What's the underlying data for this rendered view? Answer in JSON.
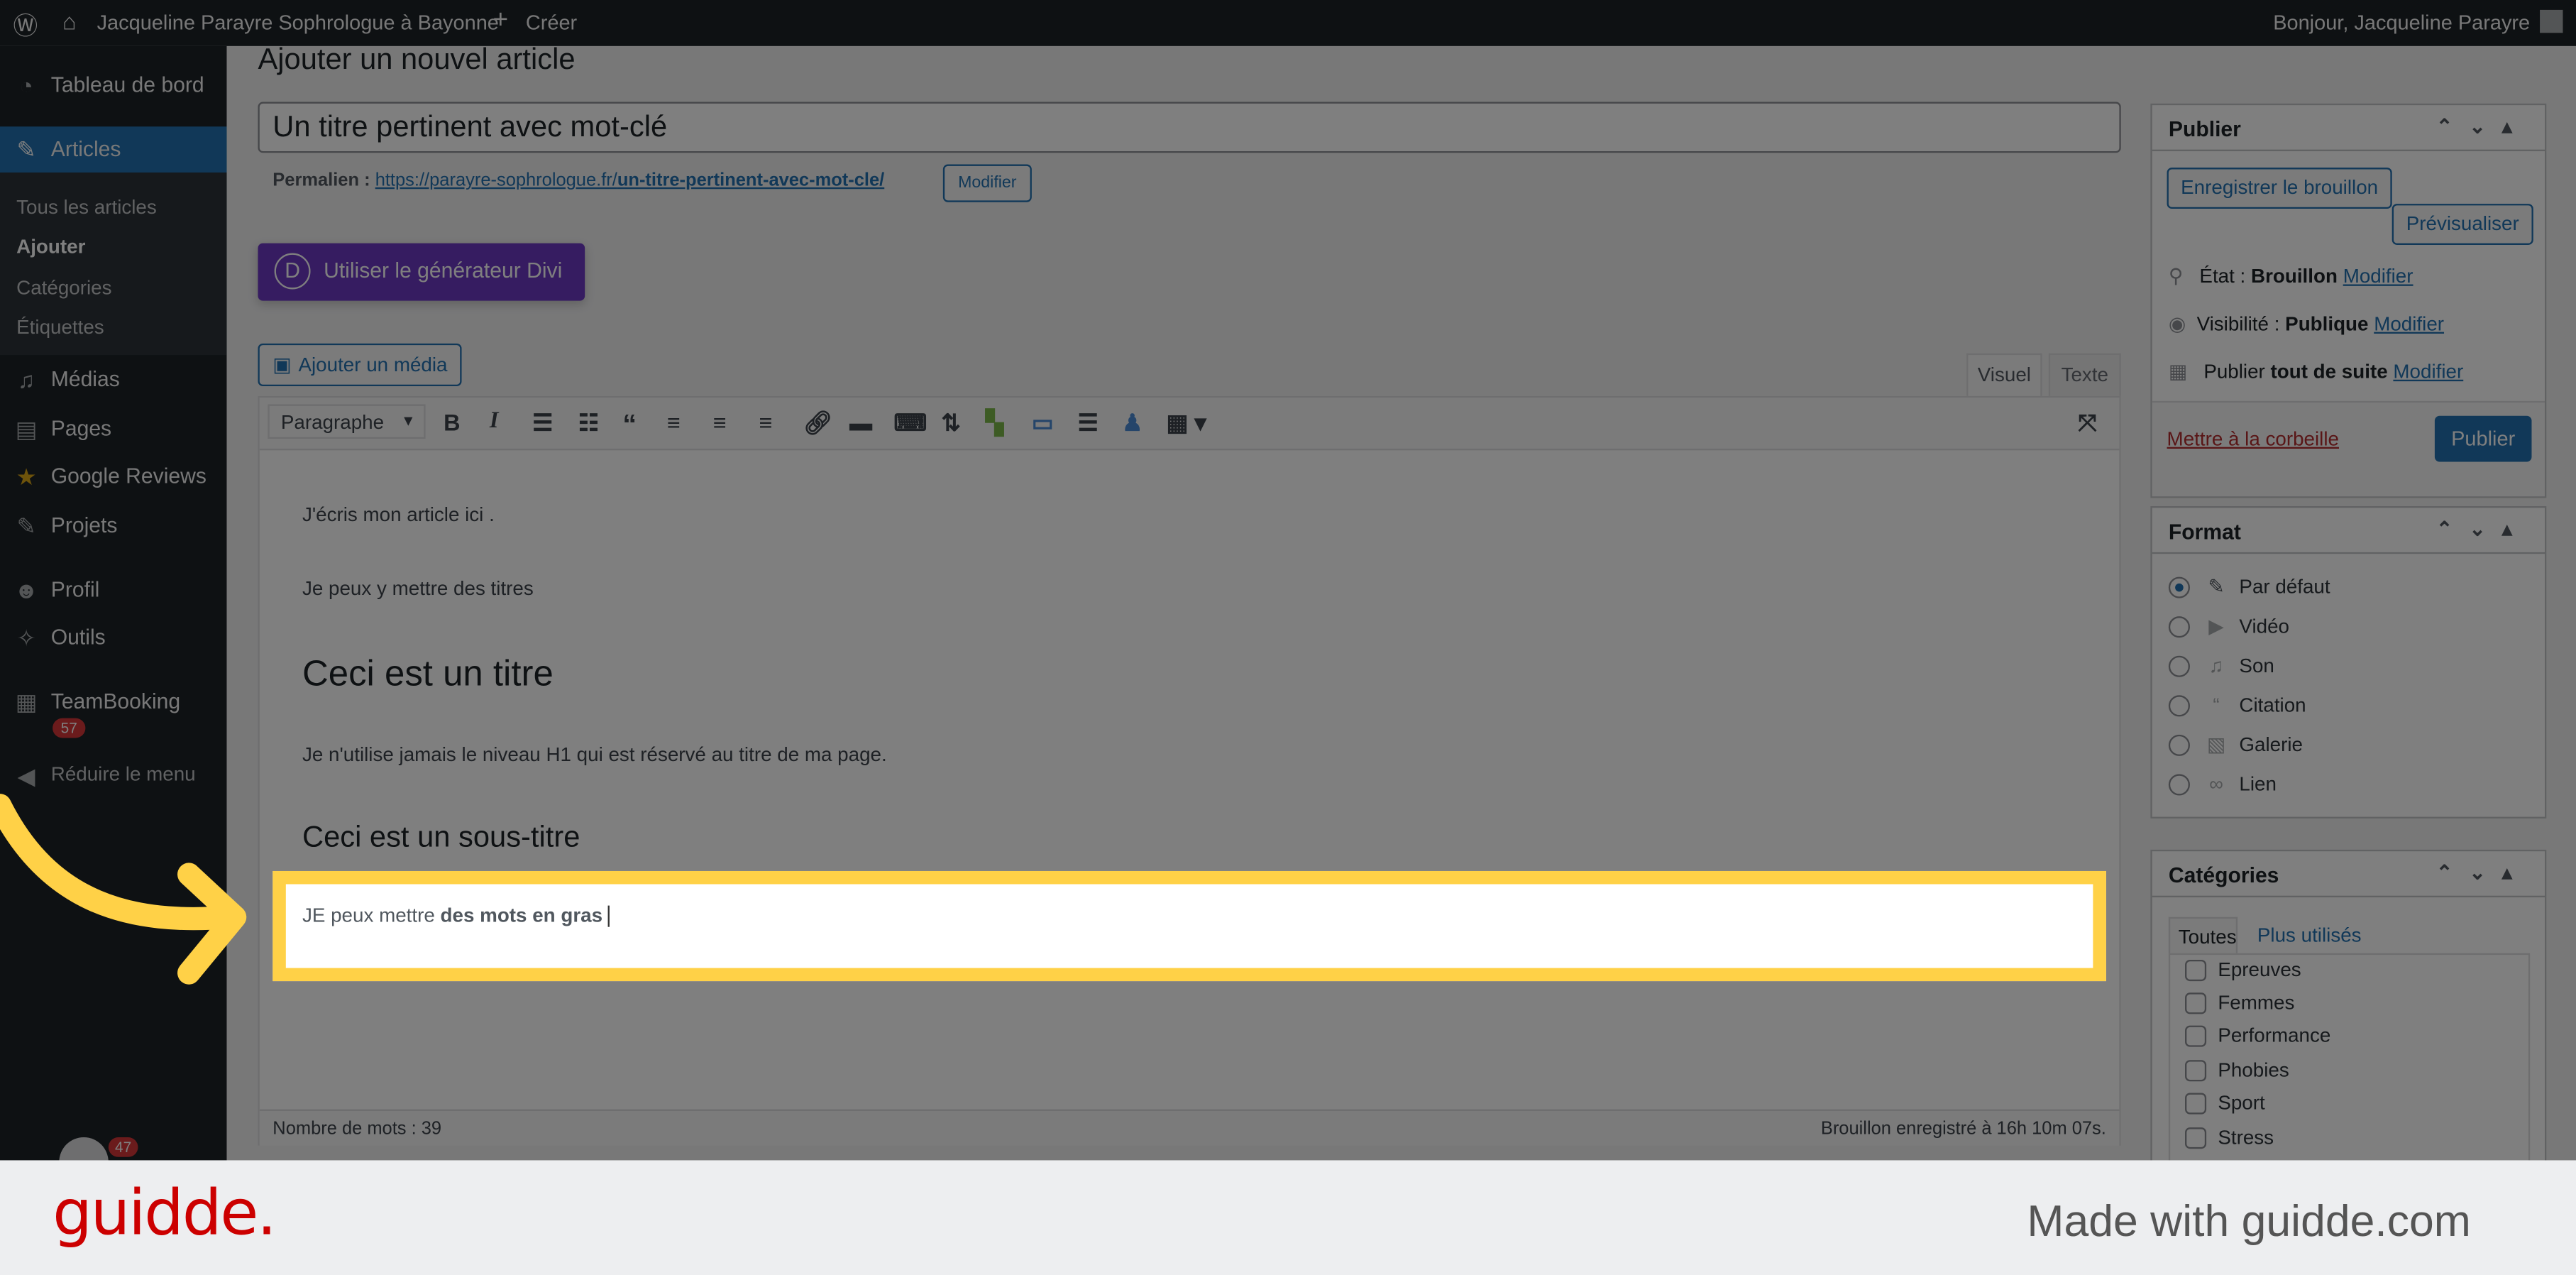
{
  "topbar": {
    "site": "Jacqueline Parayre Sophrologue à Bayonne",
    "create": "Créer",
    "greeting": "Bonjour, Jacqueline Parayre"
  },
  "sidebar": {
    "items": [
      {
        "label": "Tableau de bord",
        "icon": "dashboard-icon"
      },
      {
        "label": "Articles",
        "icon": "pin-icon"
      },
      {
        "label": "Médias",
        "icon": "media-icon"
      },
      {
        "label": "Pages",
        "icon": "pages-icon"
      },
      {
        "label": "Google Reviews",
        "icon": "star-icon"
      },
      {
        "label": "Projets",
        "icon": "pin-icon"
      },
      {
        "label": "Profil",
        "icon": "user-icon"
      },
      {
        "label": "Outils",
        "icon": "wrench-icon"
      },
      {
        "label": "TeamBooking",
        "icon": "calendar-icon"
      },
      {
        "label": "Réduire le menu",
        "icon": "collapse-icon"
      }
    ],
    "sub": [
      "Tous les articles",
      "Ajouter",
      "Catégories",
      "Étiquettes"
    ],
    "teambooking_badge": "57",
    "bottom_badge": "47"
  },
  "page": {
    "heading": "Ajouter un nouvel article",
    "title_value": "Un titre pertinent avec mot-clé",
    "permalink_label": "Permalien :",
    "permalink_base": "https://parayre-sophrologue.fr/",
    "permalink_slug": "un-titre-pertinent-avec-mot-cle/",
    "permalink_edit": "Modifier",
    "divi": "Utiliser le générateur Divi",
    "add_media": "Ajouter un média",
    "tab_visual": "Visuel",
    "tab_text": "Texte",
    "format_select": "Paragraphe"
  },
  "editor": {
    "p1": "J'écris mon article ici .",
    "p2": "Je peux y mettre des titres",
    "h2": "Ceci est un titre",
    "p3": "Je n'utilise jamais le niveau H1 qui est réservé au titre de ma page.",
    "h3": "Ceci est un sous-titre",
    "p4_normal": "JE peux mettre ",
    "p4_bold": "des mots en gras",
    "word_count": "Nombre de mots : 39",
    "saved": "Brouillon enregistré à 16h 10m 07s."
  },
  "publish": {
    "title": "Publier",
    "save_draft": "Enregistrer le brouillon",
    "preview": "Prévisualiser",
    "status_label": "État : ",
    "status": "Brouillon",
    "visibility_label": "Visibilité : ",
    "visibility": "Publique",
    "schedule_label": "Publier ",
    "schedule": "tout de suite",
    "edit": "Modifier",
    "trash": "Mettre à la corbeille",
    "publish": "Publier"
  },
  "format": {
    "title": "Format",
    "options": [
      "Par défaut",
      "Vidéo",
      "Son",
      "Citation",
      "Galerie",
      "Lien"
    ],
    "selected": "Par défaut"
  },
  "categories": {
    "title": "Catégories",
    "tab_all": "Toutes",
    "tab_popular": "Plus utilisés",
    "items": [
      "Epreuves",
      "Femmes",
      "Performance",
      "Phobies",
      "Sport",
      "Stress"
    ]
  },
  "footer": {
    "logo": "guidde.",
    "tagline": "Made with guidde.com"
  },
  "colors": {
    "highlight": "#ffd147",
    "brand": "#cc0000",
    "accent": "#2271b1",
    "divi": "#6c38c2"
  }
}
